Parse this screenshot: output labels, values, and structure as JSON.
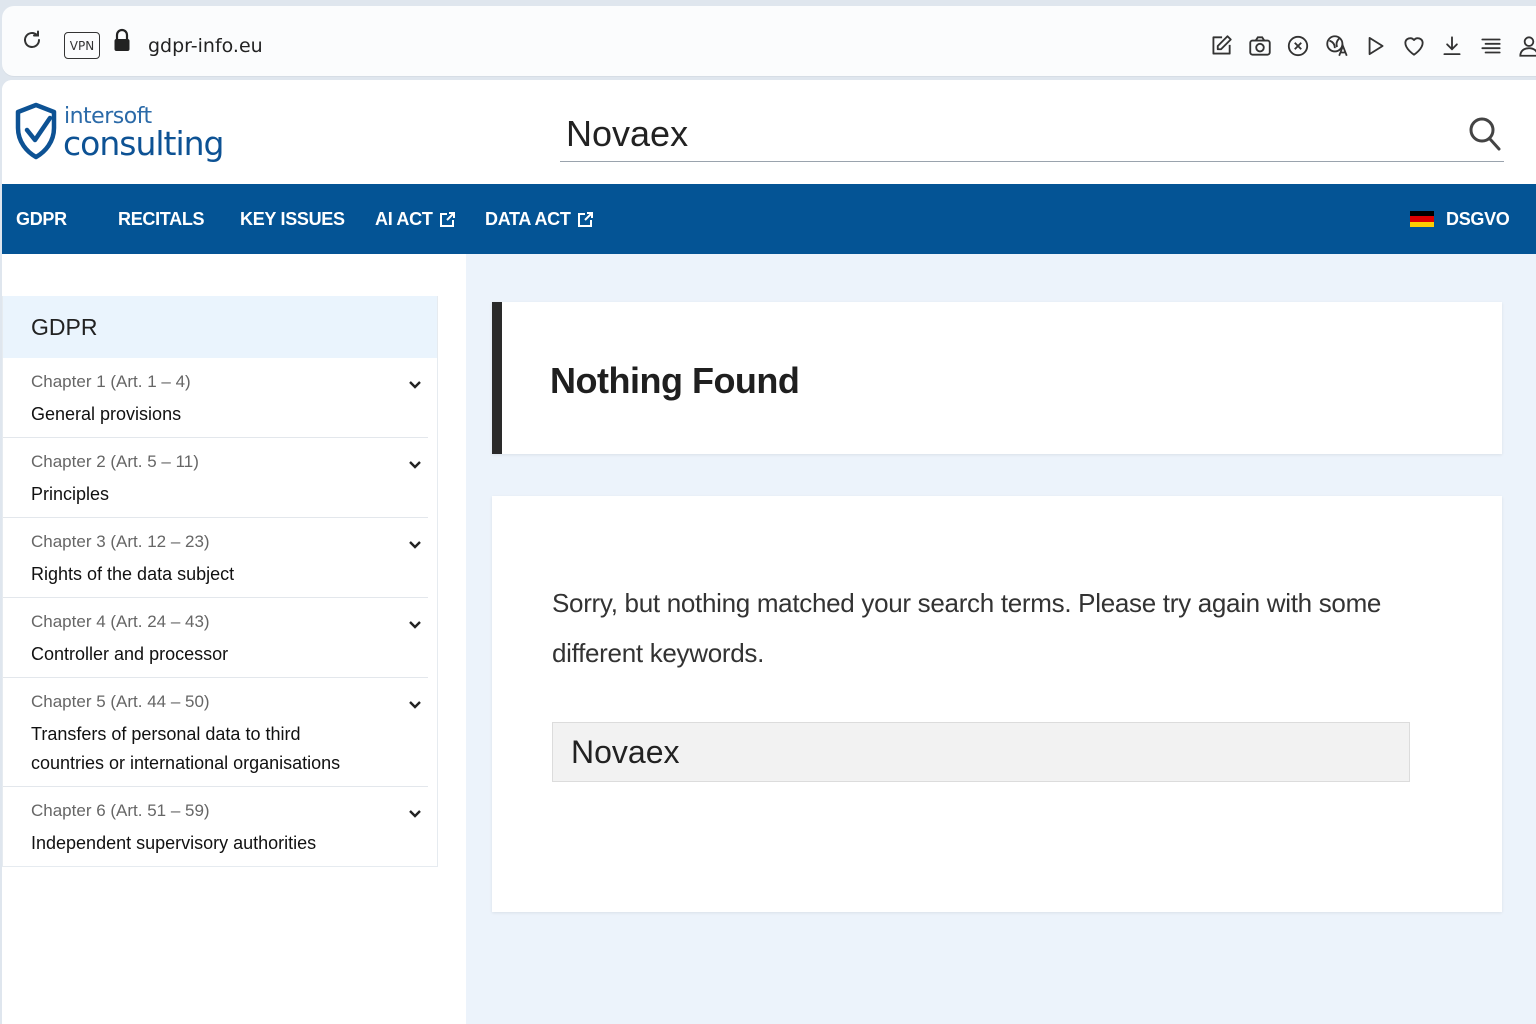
{
  "browser": {
    "vpn_label": "VPN",
    "url": "gdpr-info.eu",
    "toolbar_icons": [
      "edit-icon",
      "camera-icon",
      "close-circle-icon",
      "translate-icon",
      "play-icon",
      "heart-icon",
      "download-icon",
      "menu-icon",
      "profile-icon"
    ]
  },
  "header": {
    "logo_top": "intersoft",
    "logo_bottom": "consulting",
    "search_value": "Novaex"
  },
  "nav": {
    "items": [
      {
        "label": "GDPR",
        "external": false
      },
      {
        "label": "RECITALS",
        "external": false
      },
      {
        "label": "KEY ISSUES",
        "external": false
      },
      {
        "label": "AI ACT",
        "external": true
      },
      {
        "label": "DATA ACT",
        "external": true
      }
    ],
    "language_label": "DSGVO",
    "flag_colors": [
      "#000000",
      "#dd0000",
      "#ffce00"
    ]
  },
  "sidebar": {
    "title": "GDPR",
    "chapters": [
      {
        "number": "Chapter 1 (Art. 1 – 4)",
        "name": "General provisions"
      },
      {
        "number": "Chapter 2 (Art. 5 – 11)",
        "name": "Principles"
      },
      {
        "number": "Chapter 3 (Art. 12 – 23)",
        "name": "Rights of the data subject"
      },
      {
        "number": "Chapter 4 (Art. 24 – 43)",
        "name": "Controller and processor"
      },
      {
        "number": "Chapter 5 (Art. 44 – 50)",
        "name": "Transfers of personal data to third countries or international organisations"
      },
      {
        "number": "Chapter 6 (Art. 51 – 59)",
        "name": "Independent supervisory authorities"
      }
    ]
  },
  "main": {
    "title": "Nothing Found",
    "message": "Sorry, but nothing matched your search terms. Please try again with some different keywords.",
    "search_value": "Novaex"
  },
  "colors": {
    "nav_bg": "#045495",
    "logo_blue": "#0d5294",
    "main_bg": "#ecf3fb",
    "sidebar_title_bg": "#eaf4fd"
  }
}
